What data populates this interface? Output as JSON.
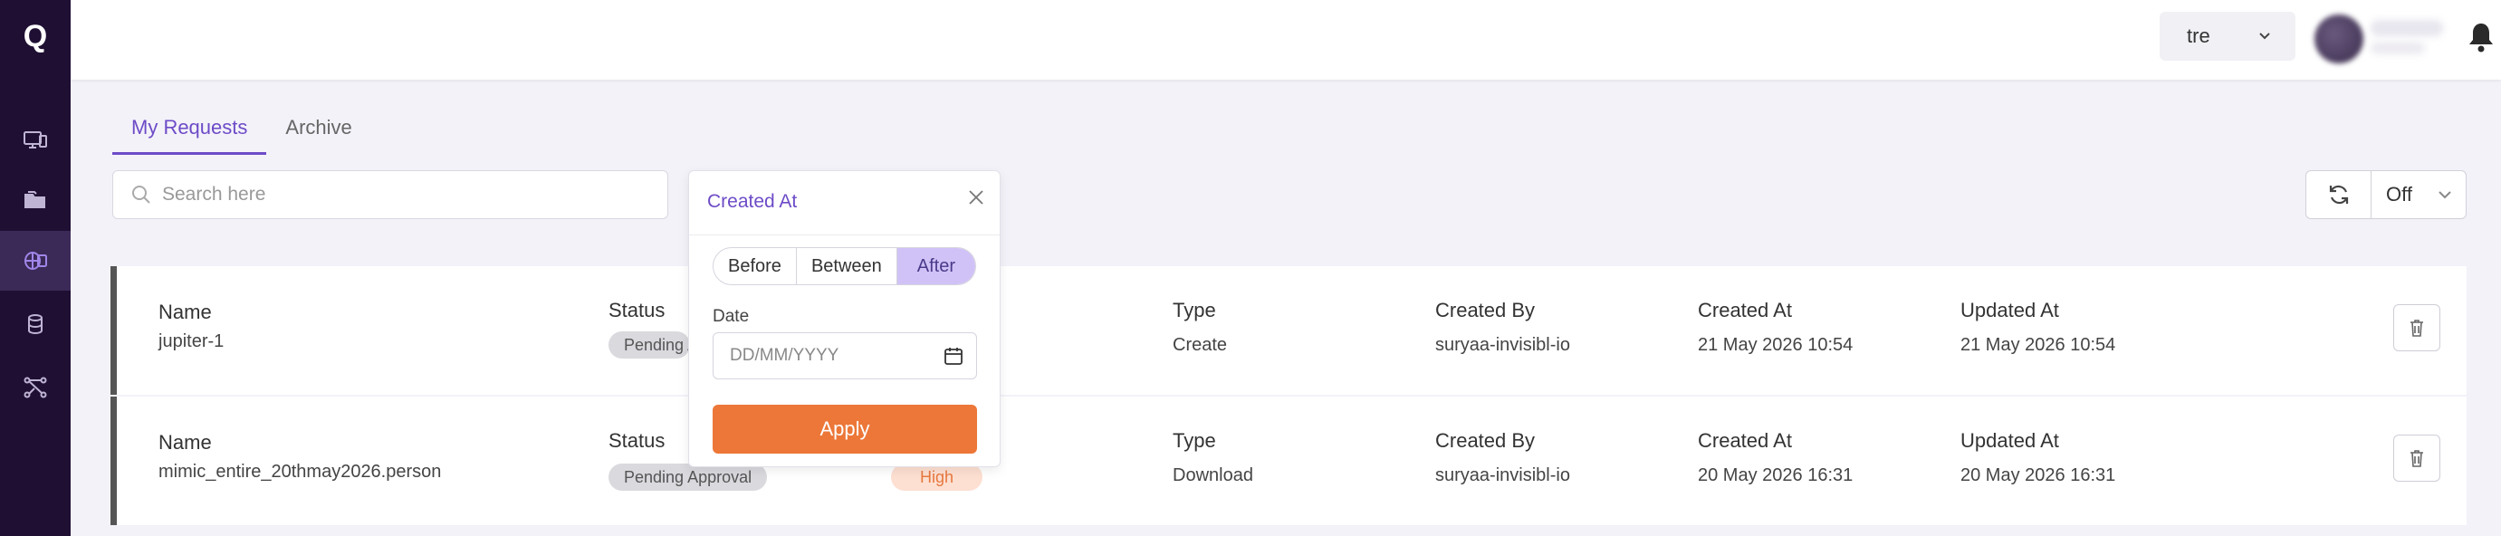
{
  "app": {
    "logo_text": "Q"
  },
  "sidebar": {
    "items": [
      {
        "name": "sidebar-item-devices",
        "icon": "monitor-icon"
      },
      {
        "name": "sidebar-item-folders",
        "icon": "folder-icon"
      },
      {
        "name": "sidebar-item-requests",
        "icon": "requests-icon",
        "active": true
      },
      {
        "name": "sidebar-item-database",
        "icon": "database-icon"
      },
      {
        "name": "sidebar-item-pipelines",
        "icon": "network-icon"
      }
    ]
  },
  "header": {
    "workspace": "tre"
  },
  "tabs": [
    {
      "label": "My Requests",
      "active": true
    },
    {
      "label": "Archive",
      "active": false
    }
  ],
  "search": {
    "placeholder": "Search here"
  },
  "refresh": {
    "value": "Off"
  },
  "rows": [
    {
      "name_label": "Name",
      "name": "jupiter-1",
      "status_label": "Status",
      "status": "Pending Approval",
      "priority": "",
      "type_label": "Type",
      "type": "Create",
      "created_by_label": "Created By",
      "created_by": "suryaa-invisibl-io",
      "created_at_label": "Created At",
      "created_at": "21 May 2026 10:54",
      "updated_at_label": "Updated At",
      "updated_at": "21 May 2026 10:54"
    },
    {
      "name_label": "Name",
      "name": "mimic_entire_20thmay2026.person",
      "status_label": "Status",
      "status": "Pending Approval",
      "priority": "High",
      "type_label": "Type",
      "type": "Download",
      "created_by_label": "Created By",
      "created_by": "suryaa-invisibl-io",
      "created_at_label": "Created At",
      "created_at": "20 May 2026 16:31",
      "updated_at_label": "Updated At",
      "updated_at": "20 May 2026 16:31"
    }
  ],
  "filter_popover": {
    "title": "Created At",
    "options": [
      "Before",
      "Between",
      "After"
    ],
    "selected": "After",
    "date_label": "Date",
    "date_placeholder": "DD/MM/YYYY",
    "apply_label": "Apply"
  },
  "colors": {
    "accent": "#6d4bc7",
    "apply": "#ec7738",
    "sidebar": "#1f0f33",
    "priority_high": "#e8783f"
  }
}
